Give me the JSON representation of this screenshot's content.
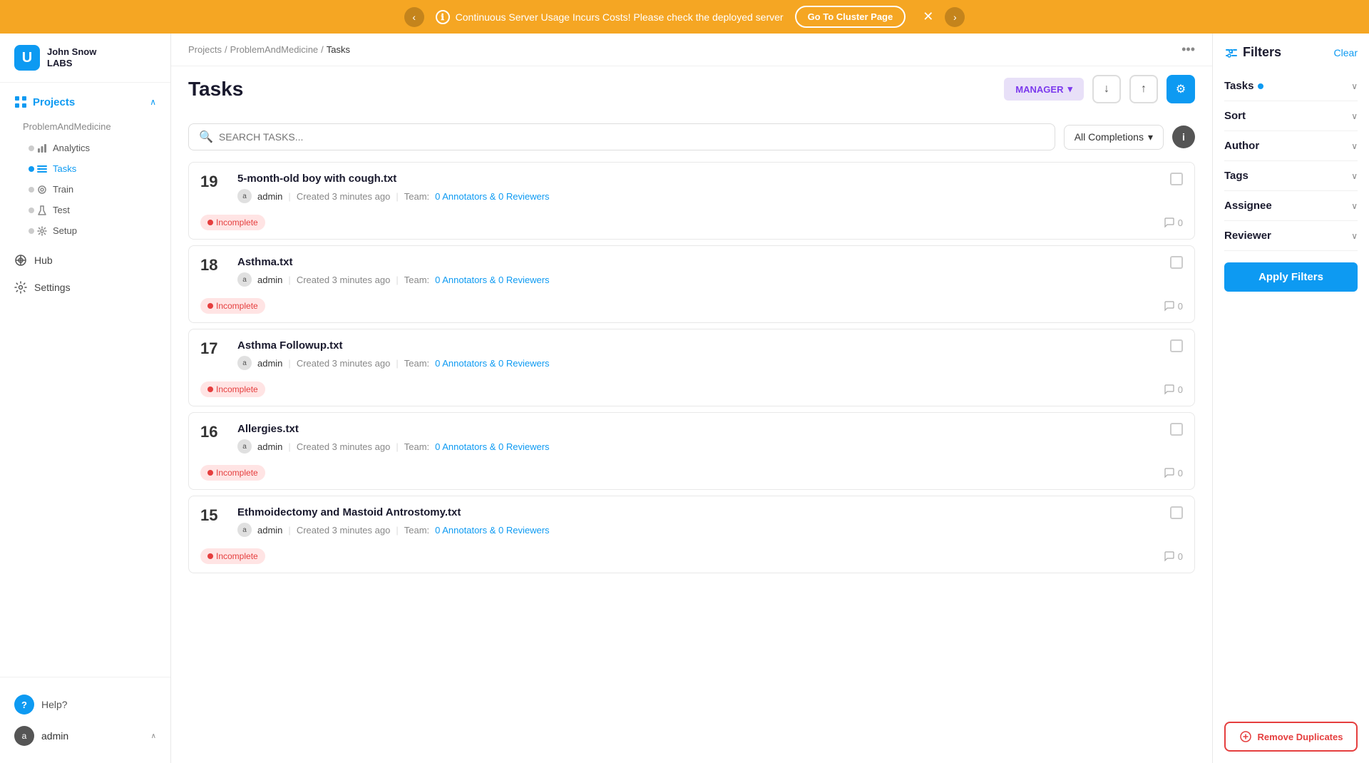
{
  "banner": {
    "message": "Continuous Server Usage Incurs Costs! Please check the deployed server",
    "button": "Go To Cluster Page",
    "info_icon": "ℹ",
    "close_icon": "✕",
    "prev_icon": "‹",
    "next_icon": "›"
  },
  "logo": {
    "name": "John Snow",
    "sub": "LABS",
    "icon_color": "#0d9af2"
  },
  "sidebar": {
    "projects_label": "Projects",
    "projects_chevron": "∧",
    "project_name": "ProblemAndMedicine",
    "nav_items": [
      {
        "id": "analytics",
        "label": "Analytics",
        "icon": "📊"
      },
      {
        "id": "tasks",
        "label": "Tasks",
        "icon": "☰",
        "active": true
      },
      {
        "id": "train",
        "label": "Train",
        "icon": "🎯"
      },
      {
        "id": "test",
        "label": "Test",
        "icon": "🔬"
      },
      {
        "id": "setup",
        "label": "Setup",
        "icon": "⚙"
      }
    ],
    "hub_label": "Hub",
    "settings_label": "Settings",
    "help_label": "Help?",
    "user_name": "admin",
    "user_initial": "a"
  },
  "breadcrumb": {
    "projects": "Projects",
    "separator1": "/",
    "project": "ProblemAndMedicine",
    "separator2": "/",
    "current": "Tasks",
    "more": "•••"
  },
  "page": {
    "title": "Tasks",
    "role_button": "MANAGER",
    "role_chevron": "▾",
    "download_icon": "↓",
    "upload_icon": "↑",
    "settings_icon": "⚙"
  },
  "search": {
    "placeholder": "SEARCH TASKS...",
    "completions_label": "All Completions",
    "completions_chevron": "▾",
    "info_label": "i"
  },
  "tasks": [
    {
      "id": 19,
      "name": "5-month-old boy with cough.txt",
      "author": "admin",
      "created": "Created 3 minutes ago",
      "team_text": "Team:",
      "team_link": "0 Annotators & 0 Reviewers",
      "status": "Incomplete",
      "comments": 0
    },
    {
      "id": 18,
      "name": "Asthma.txt",
      "author": "admin",
      "created": "Created 3 minutes ago",
      "team_text": "Team:",
      "team_link": "0 Annotators & 0 Reviewers",
      "status": "Incomplete",
      "comments": 0
    },
    {
      "id": 17,
      "name": "Asthma Followup.txt",
      "author": "admin",
      "created": "Created 3 minutes ago",
      "team_text": "Team:",
      "team_link": "0 Annotators & 0 Reviewers",
      "status": "Incomplete",
      "comments": 0
    },
    {
      "id": 16,
      "name": "Allergies.txt",
      "author": "admin",
      "created": "Created 3 minutes ago",
      "team_text": "Team:",
      "team_link": "0 Annotators & 0 Reviewers",
      "status": "Incomplete",
      "comments": 0
    },
    {
      "id": 15,
      "name": "Ethmoidectomy and Mastoid Antrostomy.txt",
      "author": "admin",
      "created": "Created 3 minutes ago",
      "team_text": "Team:",
      "team_link": "0 Annotators & 0 Reviewers",
      "status": "Incomplete",
      "comments": 0
    }
  ],
  "filters": {
    "title": "Filters",
    "clear_label": "Clear",
    "filters_icon": "⚙",
    "groups": [
      {
        "id": "tasks",
        "label": "Tasks",
        "has_dot": true
      },
      {
        "id": "sort",
        "label": "Sort",
        "has_dot": false
      },
      {
        "id": "author",
        "label": "Author",
        "has_dot": false
      },
      {
        "id": "tags",
        "label": "Tags",
        "has_dot": false
      },
      {
        "id": "assignee",
        "label": "Assignee",
        "has_dot": false
      },
      {
        "id": "reviewer",
        "label": "Reviewer",
        "has_dot": false
      }
    ],
    "apply_label": "Apply Filters",
    "remove_dup_label": "Remove Duplicates",
    "remove_dup_icon": "⚙"
  }
}
